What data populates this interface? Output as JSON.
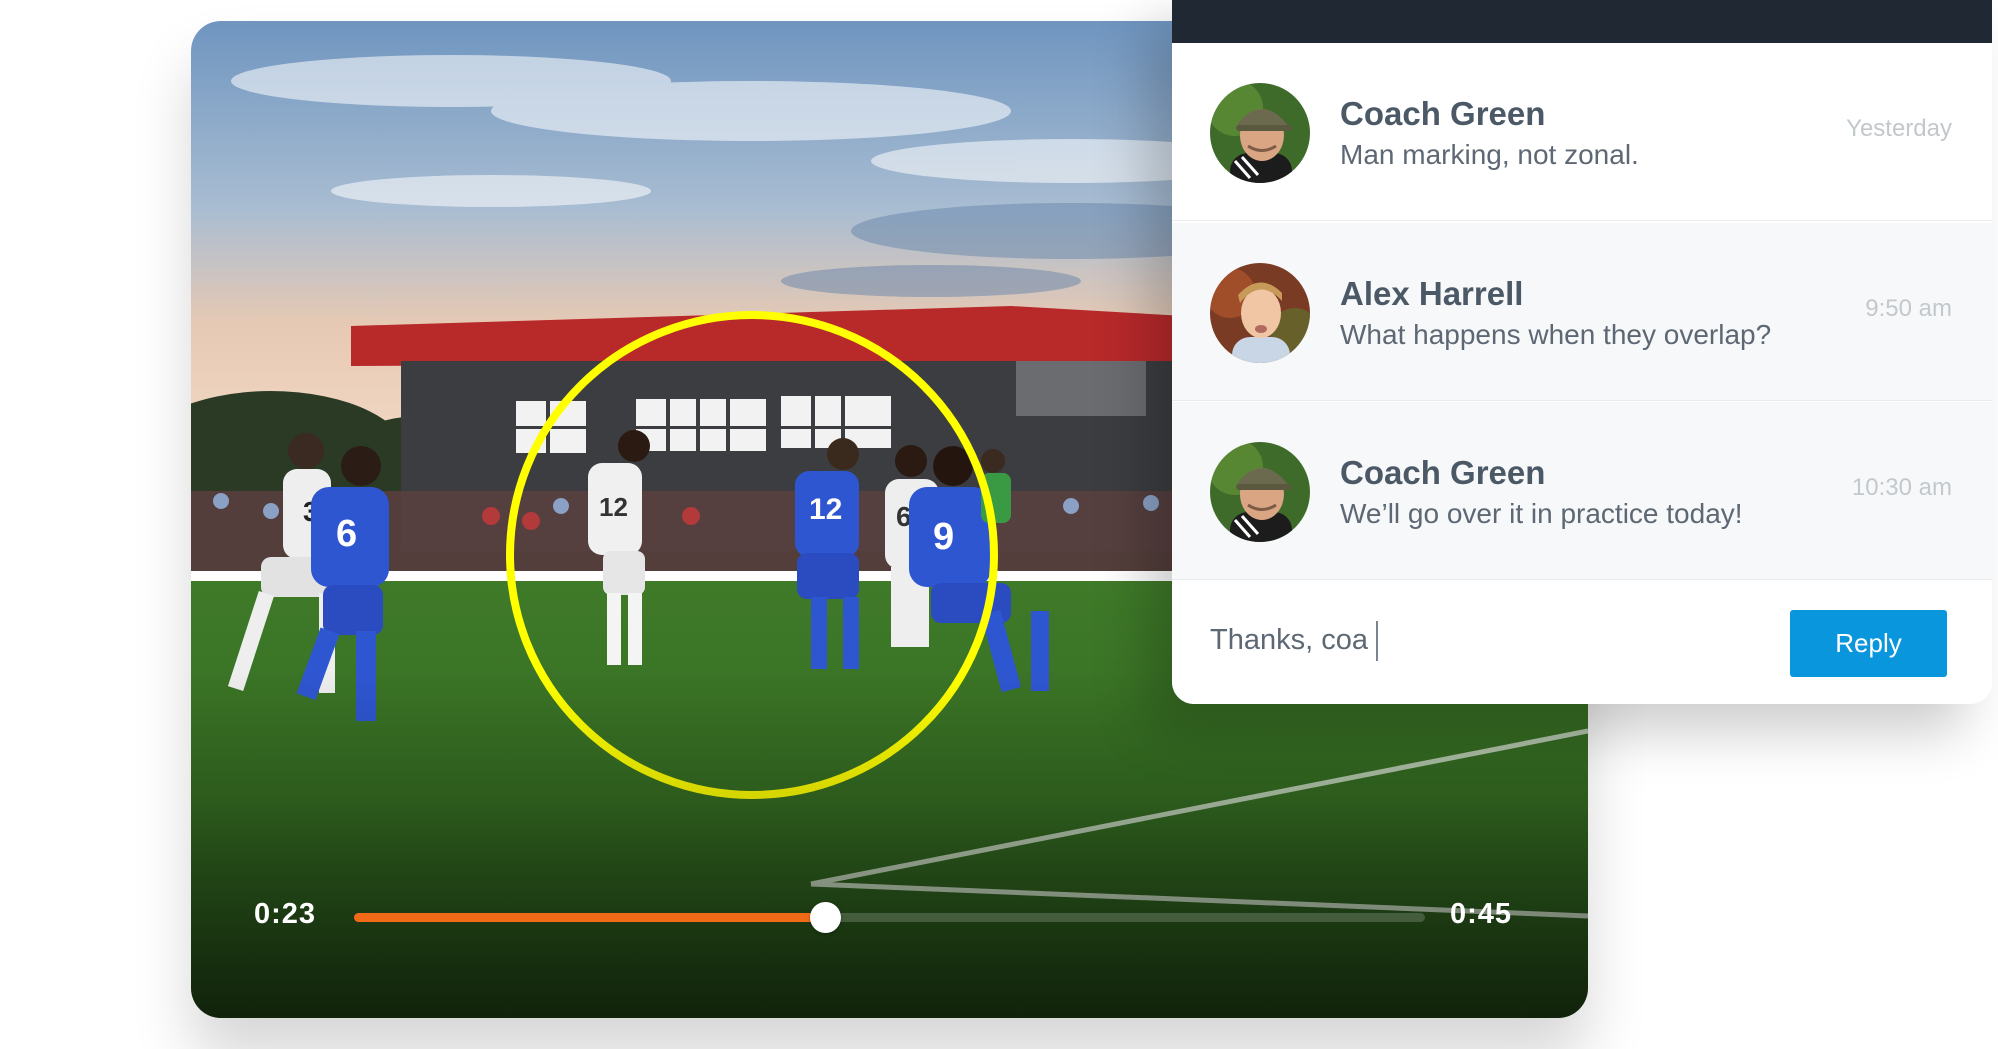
{
  "video": {
    "time_current": "0:23",
    "time_total": "0:45",
    "progress_fraction": 0.44,
    "accent_color": "#f26a17",
    "highlight_color": "#ffff00",
    "players": [
      {
        "number": "3",
        "team": "white"
      },
      {
        "number": "6",
        "team": "blue"
      },
      {
        "number": "12",
        "team": "white"
      },
      {
        "number": "12",
        "team": "blue"
      },
      {
        "number": "6",
        "team": "white"
      },
      {
        "number": "9",
        "team": "blue"
      }
    ]
  },
  "chat": {
    "messages": [
      {
        "author": "Coach Green",
        "text": "Man marking, not zonal.",
        "time": "Yesterday",
        "avatar": "coach-green-avatar"
      },
      {
        "author": "Alex Harrell",
        "text": "What happens when they overlap?",
        "time": "9:50 am",
        "avatar": "alex-harrell-avatar"
      },
      {
        "author": "Coach Green",
        "text": "We’ll go over it in practice today!",
        "time": "10:30 am",
        "avatar": "coach-green-avatar"
      }
    ],
    "reply_input_value": "Thanks, coa",
    "reply_button_label": "Reply",
    "reply_button_color": "#0a96dd",
    "header_color": "#1f2833"
  }
}
